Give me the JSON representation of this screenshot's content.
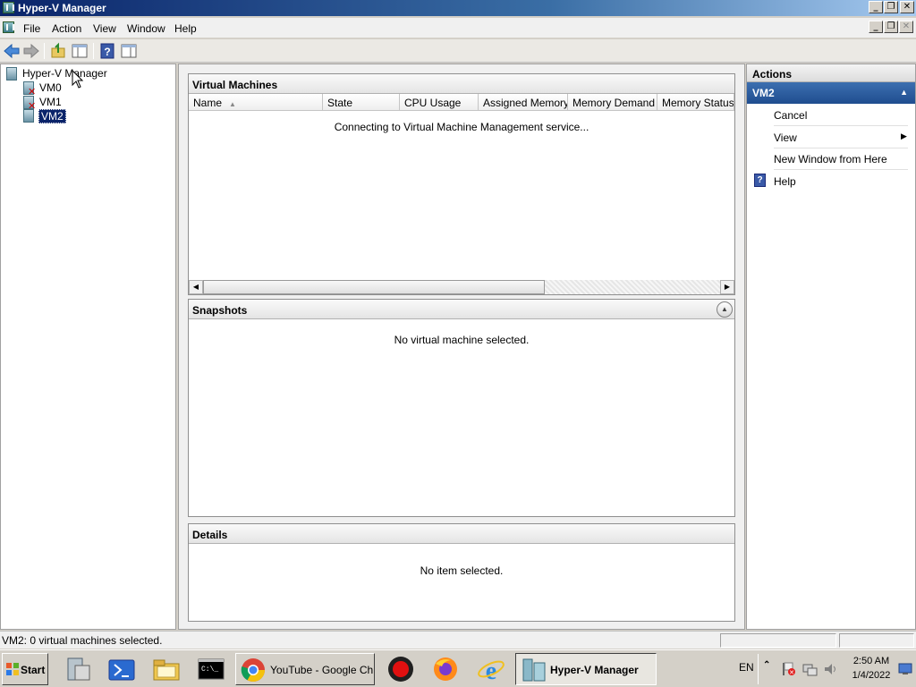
{
  "window": {
    "title": "Hyper-V Manager"
  },
  "menu": [
    "File",
    "Action",
    "View",
    "Window",
    "Help"
  ],
  "tree": {
    "root": "Hyper-V Manager",
    "items": [
      "VM0",
      "VM1",
      "VM2"
    ],
    "selected": "VM2"
  },
  "vm_panel": {
    "title": "Virtual Machines",
    "columns": [
      "Name",
      "State",
      "CPU Usage",
      "Assigned Memory",
      "Memory Demand",
      "Memory Status"
    ],
    "message": "Connecting to Virtual Machine Management service..."
  },
  "snapshots_panel": {
    "title": "Snapshots",
    "message": "No virtual machine selected."
  },
  "details_panel": {
    "title": "Details",
    "message": "No item selected."
  },
  "actions": {
    "title": "Actions",
    "section": "VM2",
    "items": [
      "Cancel",
      "View",
      "New Window from Here",
      "Help"
    ]
  },
  "status": {
    "text": "VM2:  0 virtual machines selected."
  },
  "taskbar": {
    "start": "Start",
    "chrome_label": "YouTube - Google Ch...",
    "hyperv_label": "Hyper-V Manager",
    "lang": "EN",
    "time": "2:50 AM",
    "date": "1/4/2022"
  }
}
